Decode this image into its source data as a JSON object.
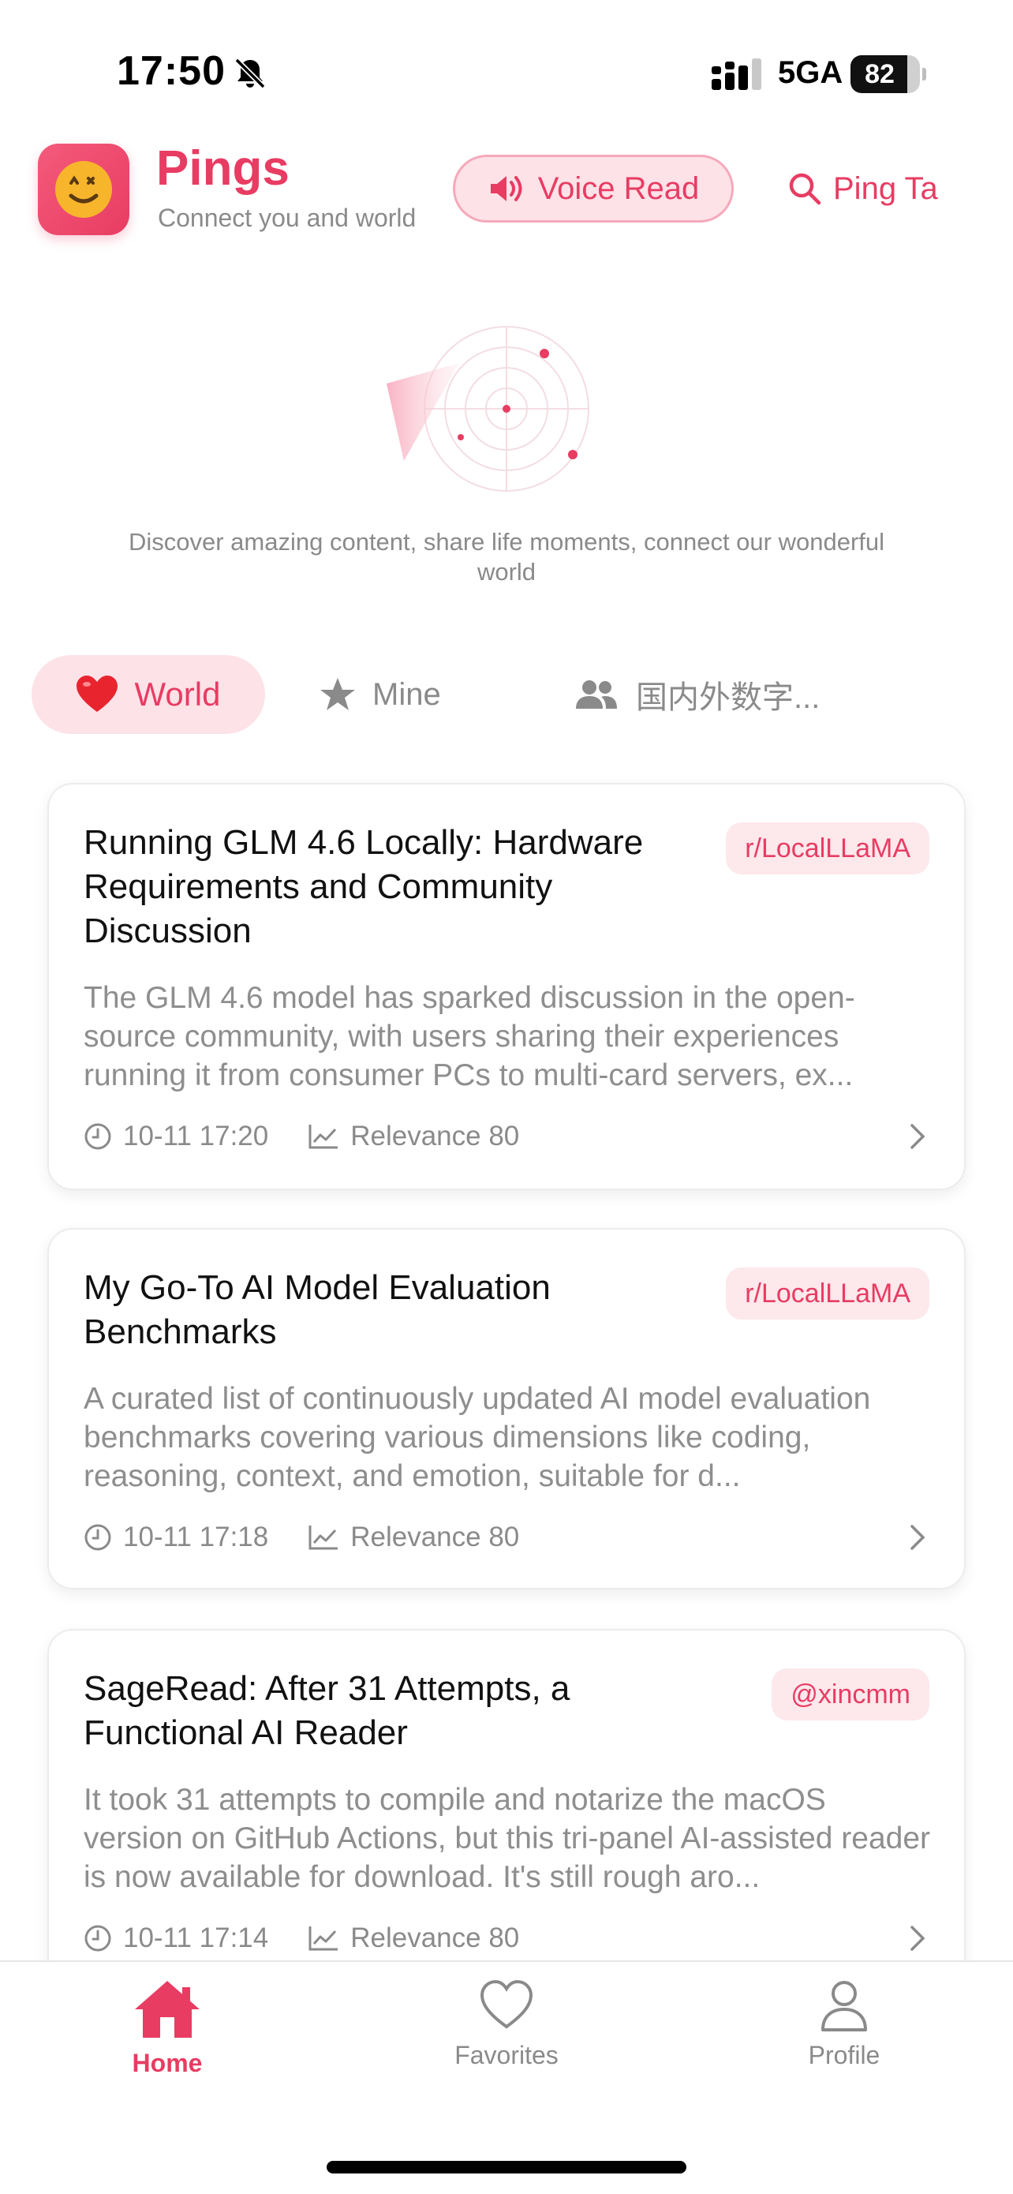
{
  "status_bar": {
    "time": "17:50",
    "network": "5GA",
    "battery": "82",
    "battery_level": 0.82
  },
  "header": {
    "app_name": "Pings",
    "tagline": "Connect you and world",
    "voice_read_label": "Voice Read",
    "ping_ta_label": "Ping Ta"
  },
  "hero": {
    "discover_text": "Discover amazing content, share life moments, connect our wonderful world"
  },
  "tabs": [
    {
      "label": "World",
      "icon": "heart-icon",
      "active": true
    },
    {
      "label": "Mine",
      "icon": "star-icon",
      "active": false
    },
    {
      "label": "国内外数字...",
      "icon": "group-icon",
      "active": false
    }
  ],
  "cards": [
    {
      "title": "Running GLM 4.6 Locally: Hardware Requirements and Community Discussion",
      "tag": "r/LocalLLaMA",
      "summary": "The GLM 4.6 model has sparked discussion in the open-source community, with users sharing their experiences running it from consumer PCs to multi-card servers, ex...",
      "time": "10-11 17:20",
      "relevance": "Relevance 80"
    },
    {
      "title": "My Go-To AI Model Evaluation Benchmarks",
      "tag": "r/LocalLLaMA",
      "summary": "A curated list of continuously updated AI model evaluation benchmarks covering various dimensions like coding, reasoning, context, and emotion, suitable for d...",
      "time": "10-11 17:18",
      "relevance": "Relevance 80"
    },
    {
      "title": "SageRead: After 31 Attempts, a Functional AI Reader",
      "tag": "@xincmm",
      "summary": "It took 31 attempts to compile and notarize the macOS version on GitHub Actions, but this tri-panel AI-assisted reader is now available for download. It's still rough aro...",
      "time": "10-11 17:14",
      "relevance": "Relevance 80"
    }
  ],
  "bottom_nav": [
    {
      "label": "Home",
      "icon": "home-icon",
      "active": true
    },
    {
      "label": "Favorites",
      "icon": "heart-outline-icon",
      "active": false
    },
    {
      "label": "Profile",
      "icon": "person-icon",
      "active": false
    }
  ],
  "colors": {
    "accent": "#e83c63",
    "accent_light": "#fde2e8",
    "muted_text": "#8a8a8a"
  }
}
